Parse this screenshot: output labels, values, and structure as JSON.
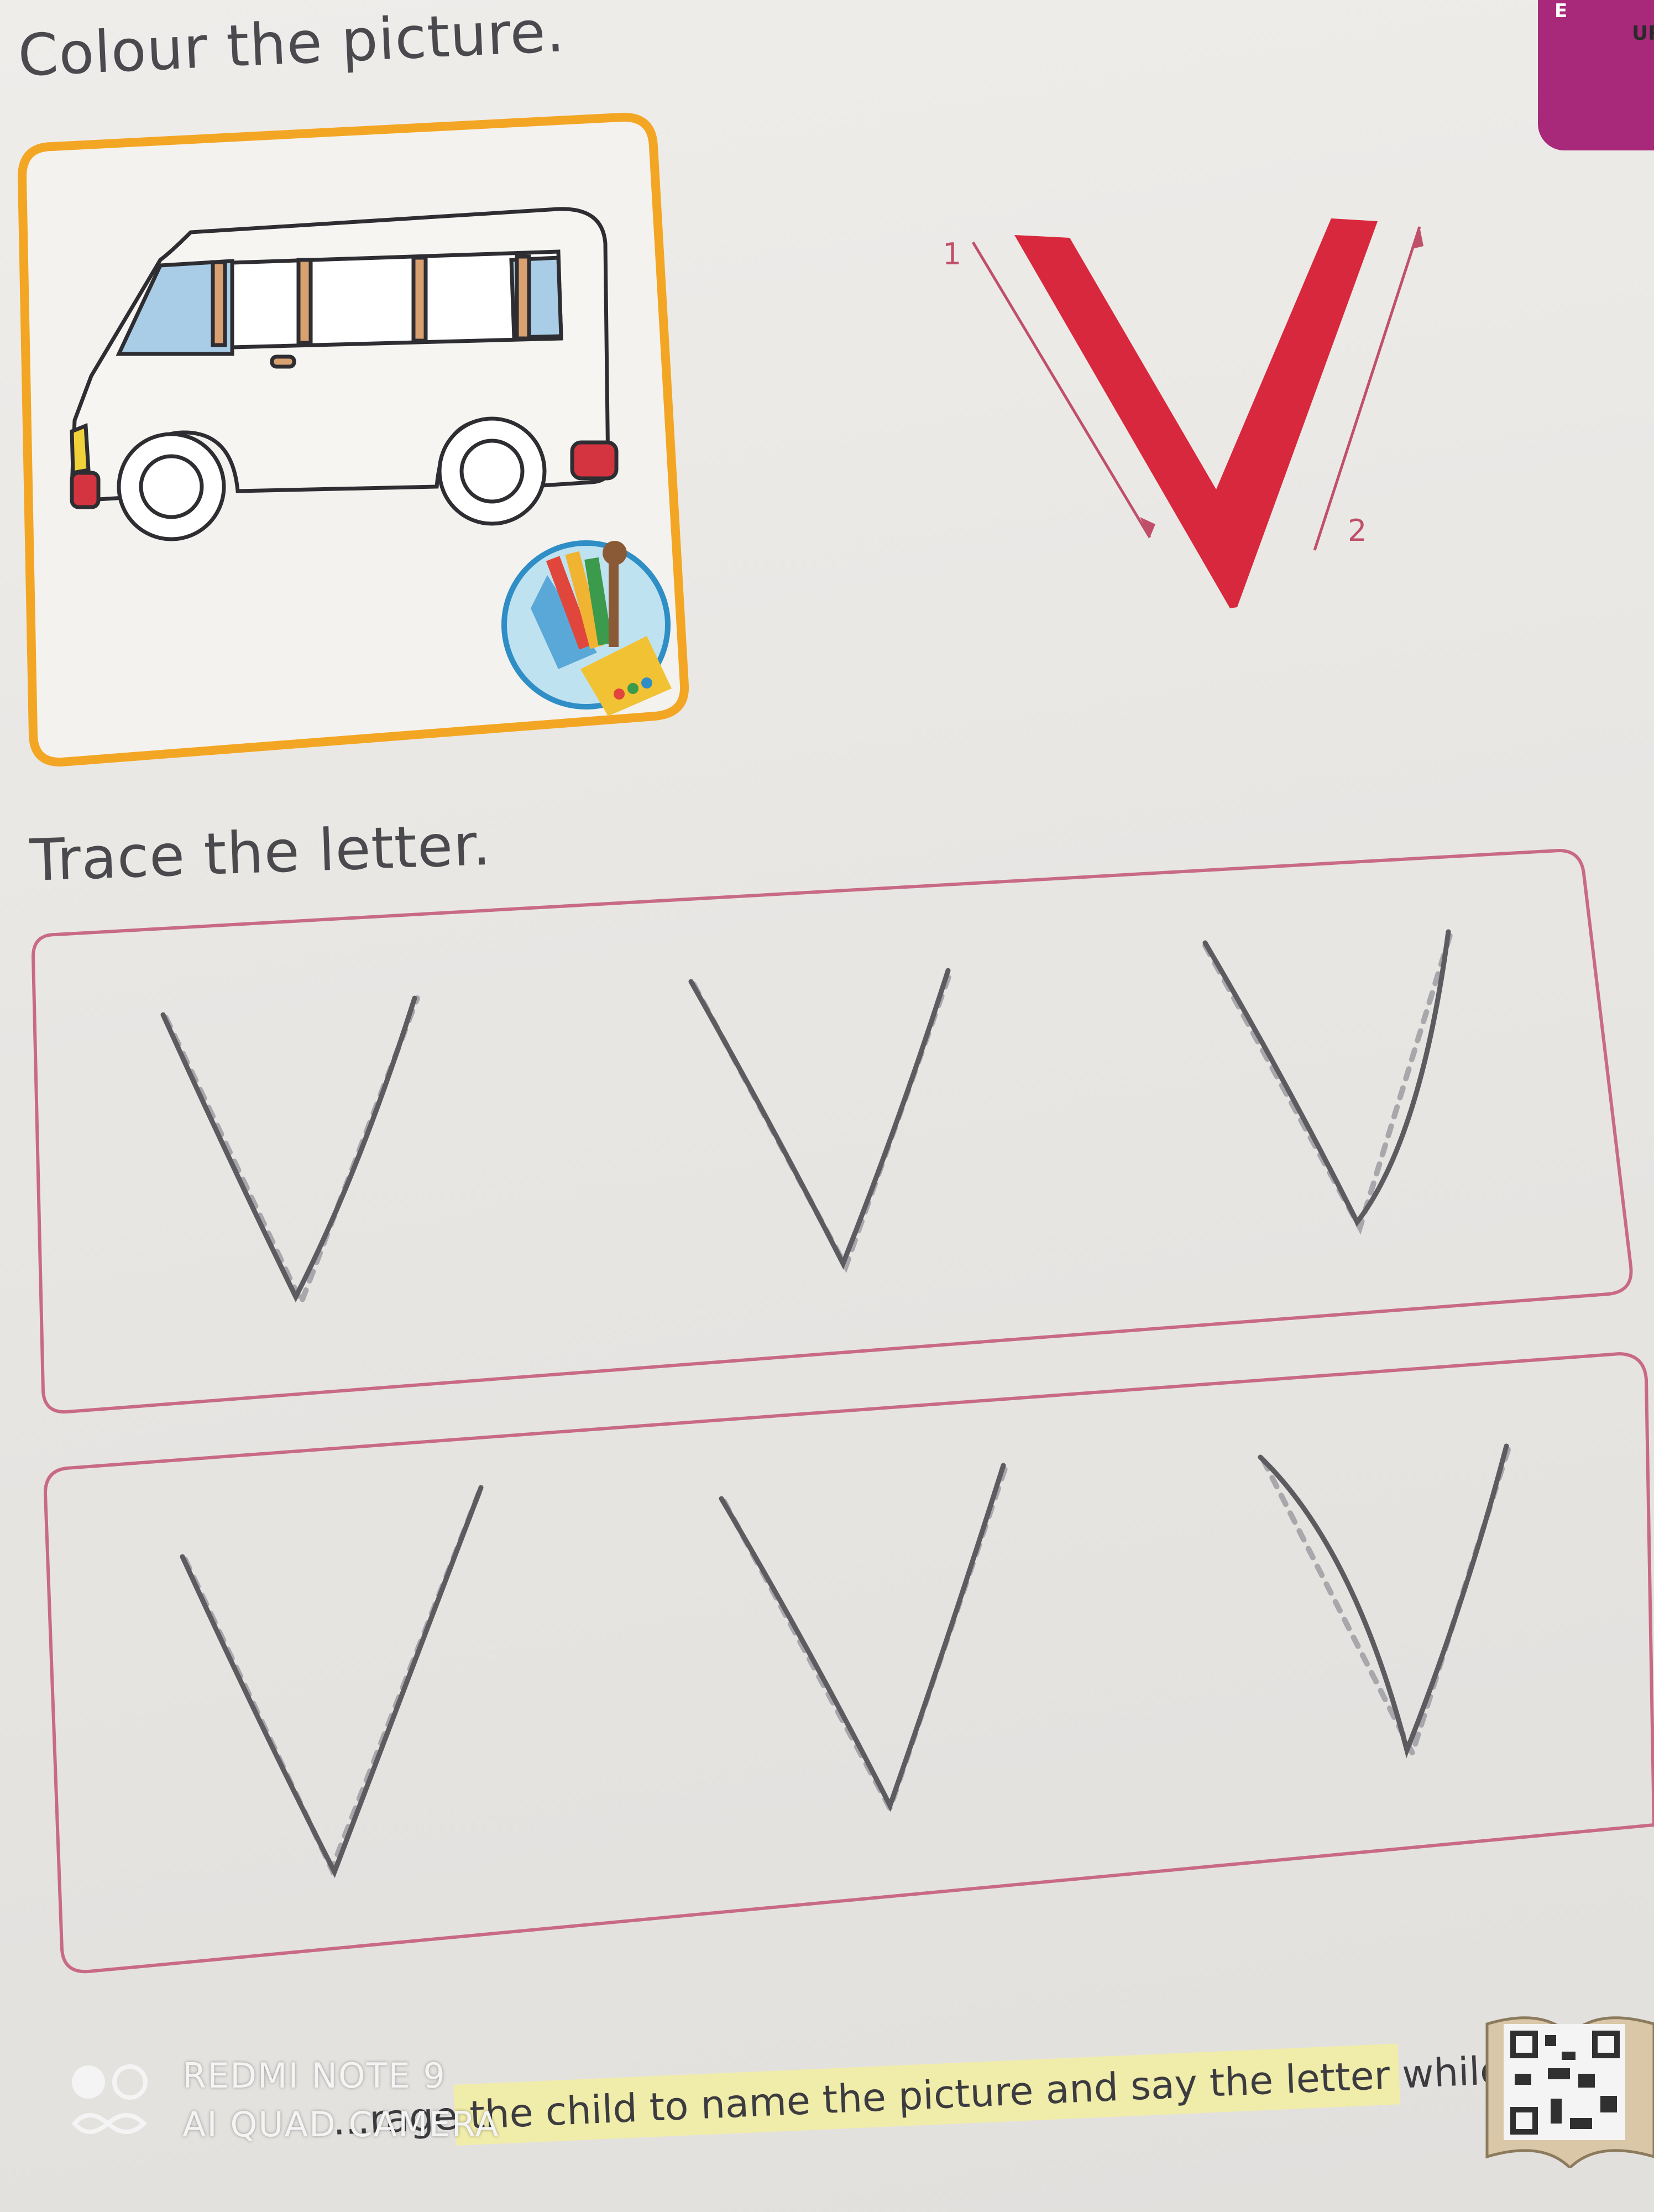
{
  "worksheet": {
    "colour_heading": "Colour the picture.",
    "trace_heading": "Trace the letter.",
    "model_letter": "V",
    "stroke_numbers": [
      "1",
      "2"
    ],
    "side_tab_letter": "E",
    "corner_letters": "UR",
    "footer_note": "...rage the child to name the picture and say the letter while tracing."
  },
  "camera_watermark": {
    "line1": "REDMI NOTE 9",
    "line2": "AI QUAD CAMERA"
  },
  "colors": {
    "letter_red": "#d8283e",
    "frame_orange": "#f3a623",
    "tab_magenta": "#a8287a",
    "guide_line": "#c86a86",
    "pencil": "#5c5c60",
    "footer_highlight": "#f0ecaa"
  },
  "icons": [
    "van-picture",
    "pencils-badge",
    "qr-code-icon",
    "camera-logo-icon"
  ]
}
